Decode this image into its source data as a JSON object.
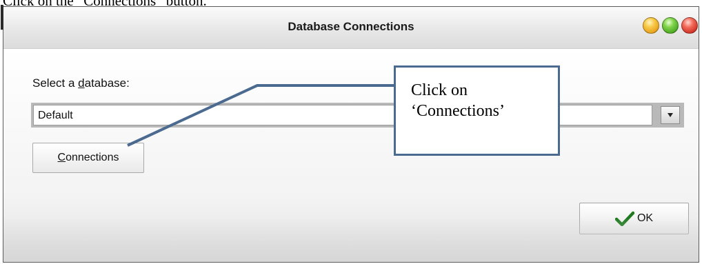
{
  "caption": {
    "text": "Click on the “Connections” button."
  },
  "window": {
    "title": "Database Connections",
    "controls": [
      "minimize",
      "maximize",
      "close"
    ]
  },
  "form": {
    "select_label_prefix": "Select a ",
    "select_label_accel": "d",
    "select_label_suffix": "atabase:",
    "database_value": "Default",
    "connections_accel": "C",
    "connections_rest": "onnections",
    "ok_label": "OK"
  },
  "callout": {
    "line1": "Click on",
    "line2": "‘Connections’"
  },
  "colors": {
    "callout_border": "#4a6a90",
    "ok_check": "#1f7a1f"
  }
}
